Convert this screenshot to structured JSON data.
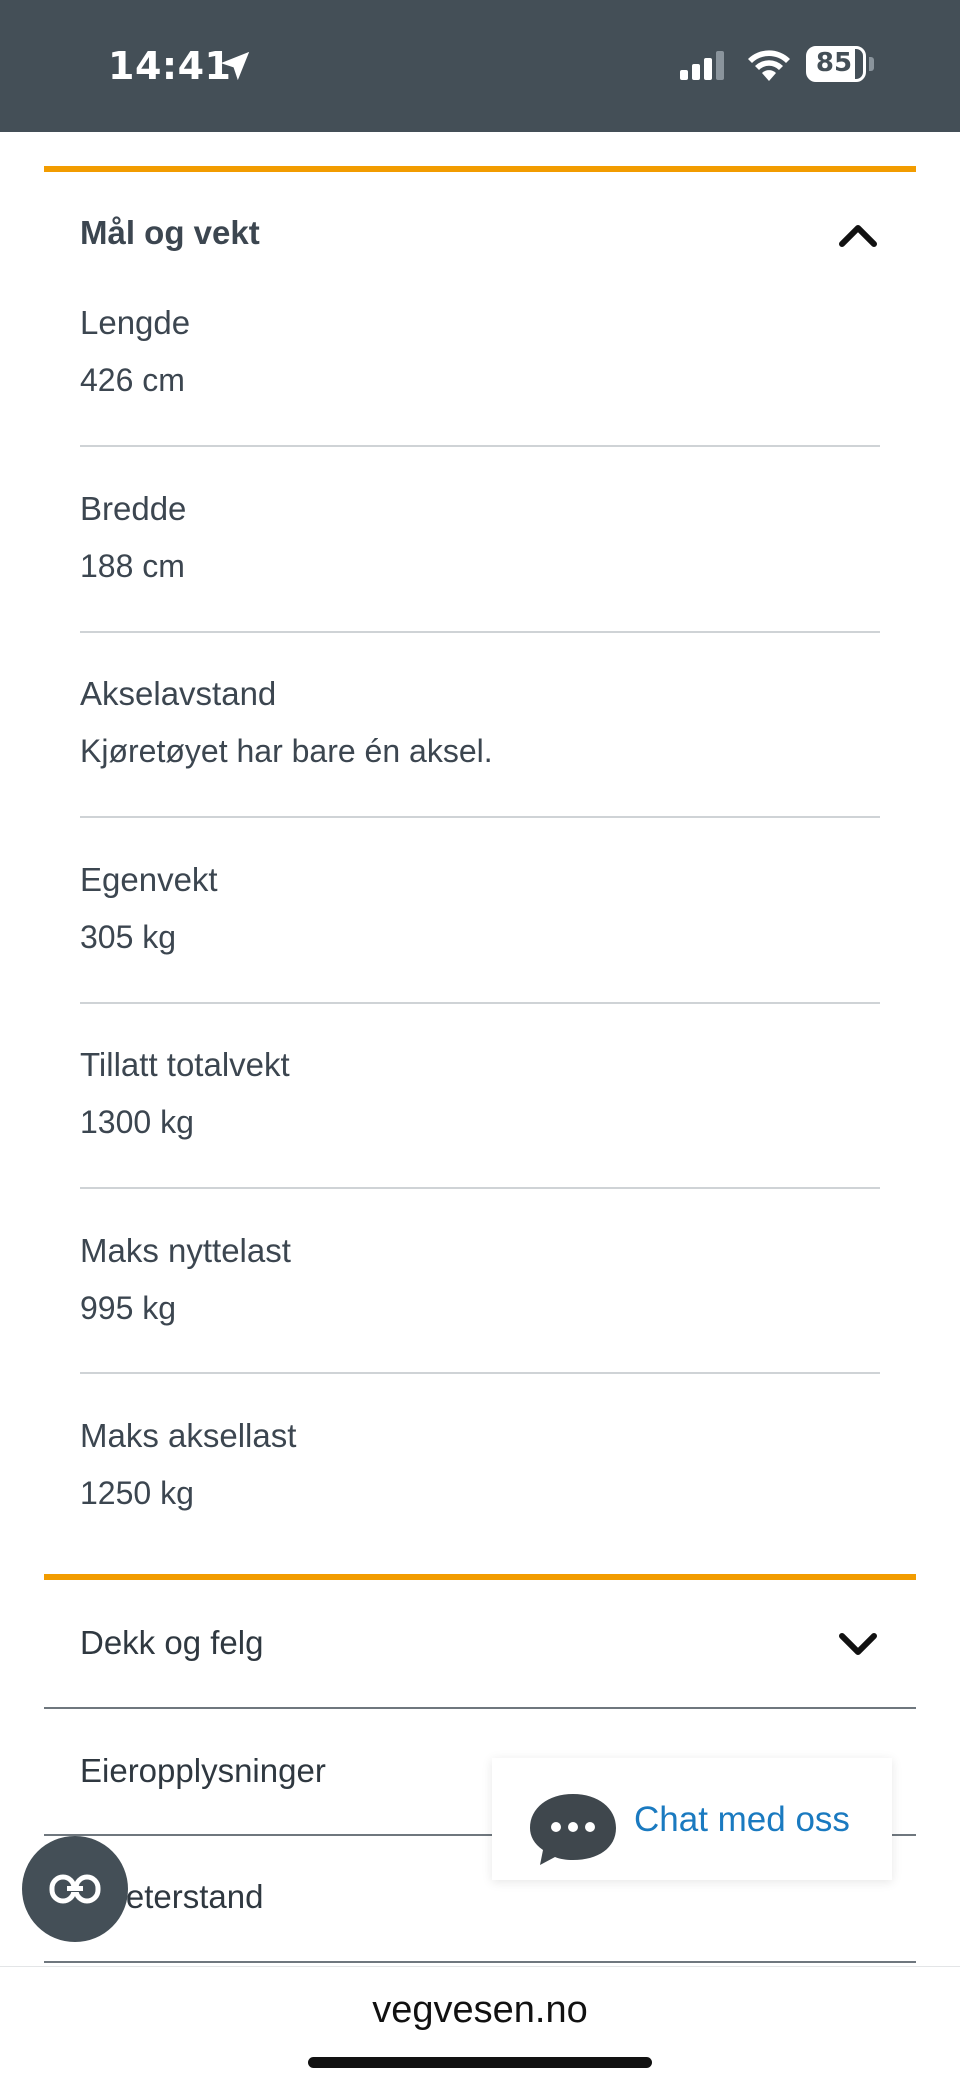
{
  "status_bar": {
    "time": "14:41",
    "battery": "85"
  },
  "sections": {
    "maal_og_vekt": {
      "title": "Mål og vekt",
      "rows": [
        {
          "label": "Lengde",
          "value": "426 cm"
        },
        {
          "label": "Bredde",
          "value": "188 cm"
        },
        {
          "label": "Akselavstand",
          "value": "Kjøretøyet har bare én aksel."
        },
        {
          "label": "Egenvekt",
          "value": "305 kg"
        },
        {
          "label": "Tillatt totalvekt",
          "value": "1300 kg"
        },
        {
          "label": "Maks nyttelast",
          "value": "995 kg"
        },
        {
          "label": "Maks aksellast",
          "value": "1250 kg"
        }
      ]
    },
    "dekk_og_felg": {
      "title": "Dekk og felg"
    },
    "eieropplysninger": {
      "title": "Eieropplysninger"
    },
    "kilometerstand": {
      "title": "ometerstand"
    }
  },
  "chat": {
    "label": "Chat med oss"
  },
  "browser": {
    "url": "vegvesen.no"
  },
  "colors": {
    "accent": "#f29c00",
    "status_bar": "#444f57",
    "link": "#1a7ac0"
  },
  "icons": [
    "location-arrow-icon",
    "signal-icon",
    "wifi-icon",
    "battery-icon",
    "chevron-up-icon",
    "chevron-down-icon",
    "chat-bubble-icon",
    "glasses-icon"
  ]
}
